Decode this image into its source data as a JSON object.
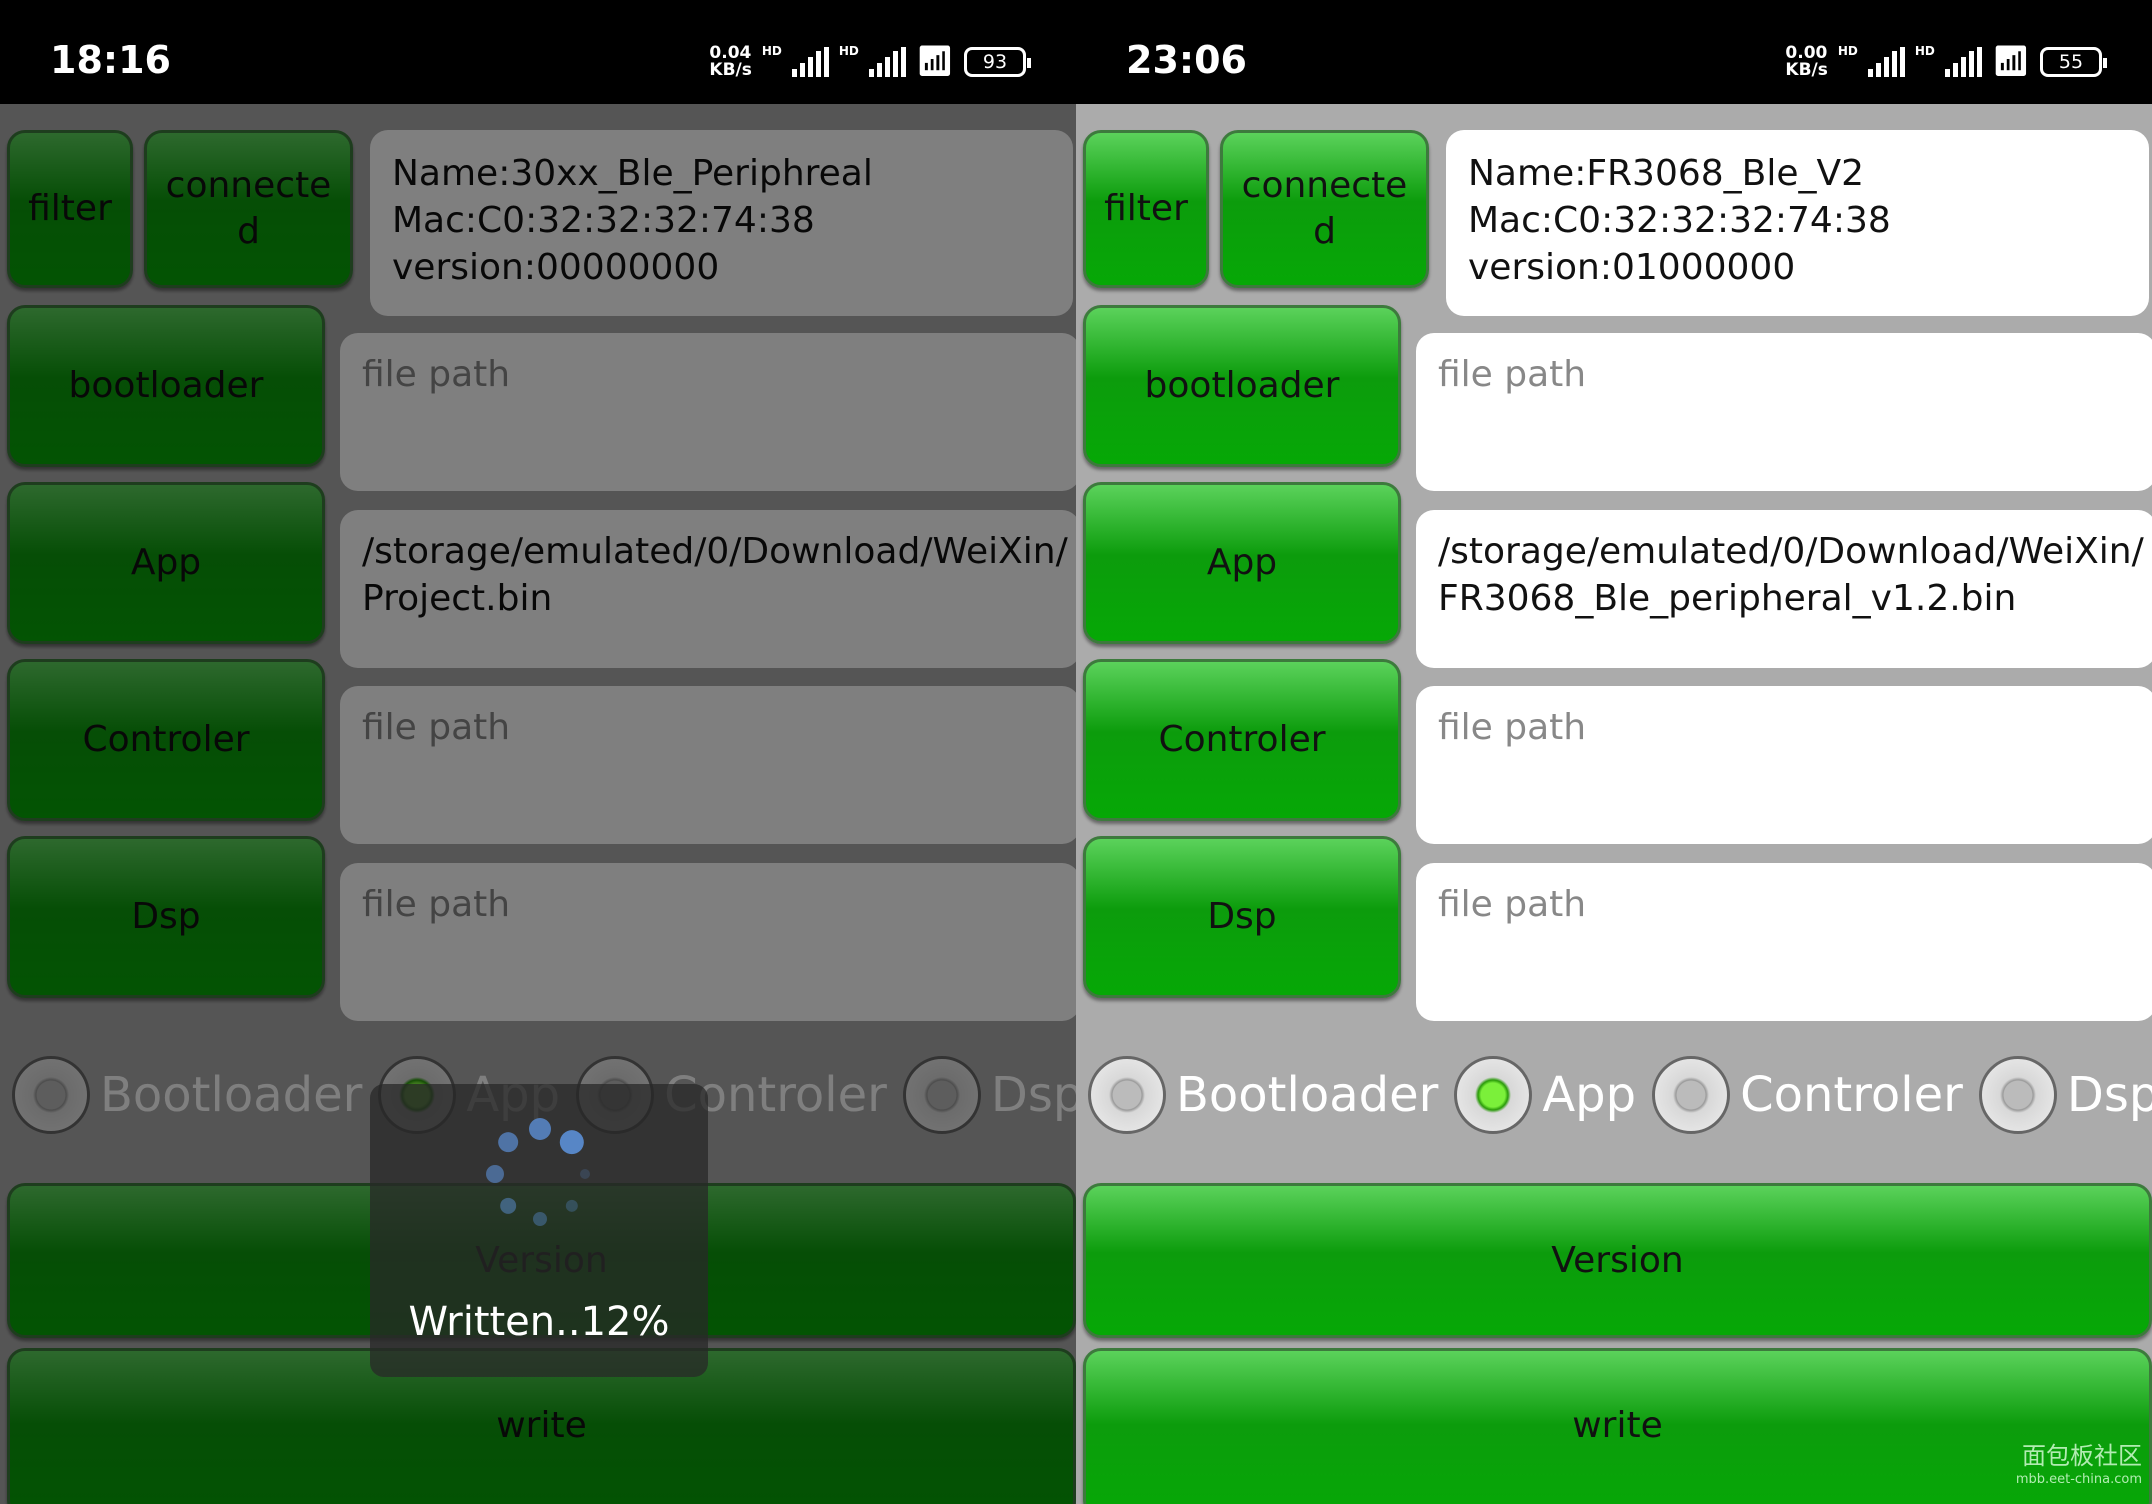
{
  "panels": [
    {
      "status": {
        "time": "18:16",
        "speed": "0.04",
        "speed_unit": "KB/s",
        "hd": "HD",
        "battery": "93"
      },
      "buttons": {
        "filter": "filter",
        "connected": "connecte d",
        "bootloader": "bootloader",
        "app": "App",
        "controler": "Controler",
        "dsp": "Dsp",
        "version": "Version",
        "write": "write"
      },
      "info": {
        "name": "Name:30xx_Ble_Periphreal",
        "mac": "Mac:C0:32:32:32:74:38",
        "version": "version:00000000"
      },
      "paths": {
        "bootloader": "",
        "app": "/storage/emulated/0/Download/WeiXin/ Project.bin",
        "controler": "",
        "dsp": ""
      },
      "placeholder": "file path",
      "radios": [
        "Bootloader",
        "App",
        "Controler",
        "Dsp"
      ],
      "selected": "App",
      "dialog": {
        "text": "Written..12%",
        "progress_percent": 12
      }
    },
    {
      "status": {
        "time": "23:06",
        "speed": "0.00",
        "speed_unit": "KB/s",
        "hd": "HD",
        "battery": "55"
      },
      "buttons": {
        "filter": "filter",
        "connected": "connecte d",
        "bootloader": "bootloader",
        "app": "App",
        "controler": "Controler",
        "dsp": "Dsp",
        "version": "Version",
        "write": "write"
      },
      "info": {
        "name": "Name:FR3068_Ble_V2",
        "mac": "Mac:C0:32:32:32:74:38",
        "version": "version:01000000"
      },
      "paths": {
        "bootloader": "",
        "app": "/storage/emulated/0/Download/WeiXin/ FR3068_Ble_peripheral_v1.2.bin",
        "controler": "",
        "dsp": ""
      },
      "placeholder": "file path",
      "radios": [
        "Bootloader",
        "App",
        "Controler",
        "Dsp"
      ],
      "selected": "App"
    }
  ],
  "watermark": {
    "title": "面包板社区",
    "url": "mbb.eet-china.com"
  },
  "colors": {
    "button_green": "#0c9c0c",
    "radio_selected": "#7bf03a",
    "background": "#ababab"
  }
}
